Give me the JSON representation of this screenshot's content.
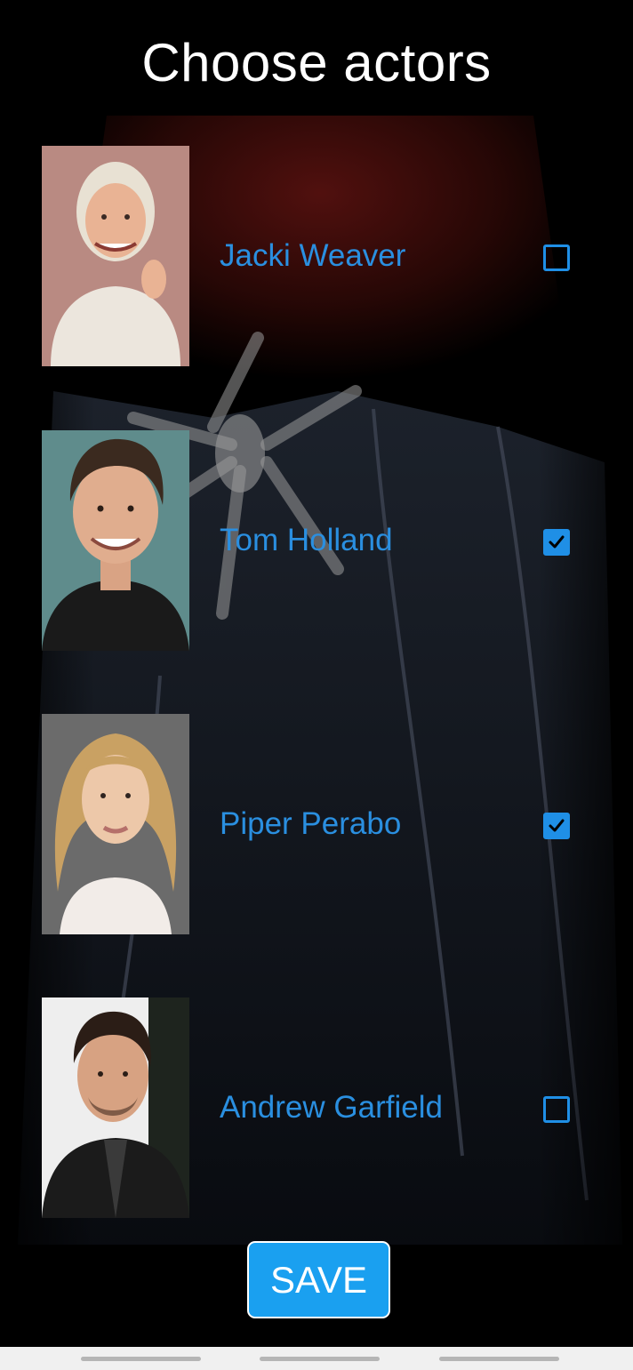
{
  "title": "Choose actors",
  "actors": [
    {
      "name": "Jacki Weaver",
      "checked": false
    },
    {
      "name": "Tom Holland",
      "checked": true
    },
    {
      "name": "Piper Perabo",
      "checked": true
    },
    {
      "name": "Andrew Garfield",
      "checked": false
    }
  ],
  "save_label": "SAVE",
  "colors": {
    "accent": "#1f8fe6",
    "name_text": "#2a8fe0",
    "save_bg": "#1aa0f0",
    "title_text": "#ffffff",
    "background": "#000000"
  }
}
